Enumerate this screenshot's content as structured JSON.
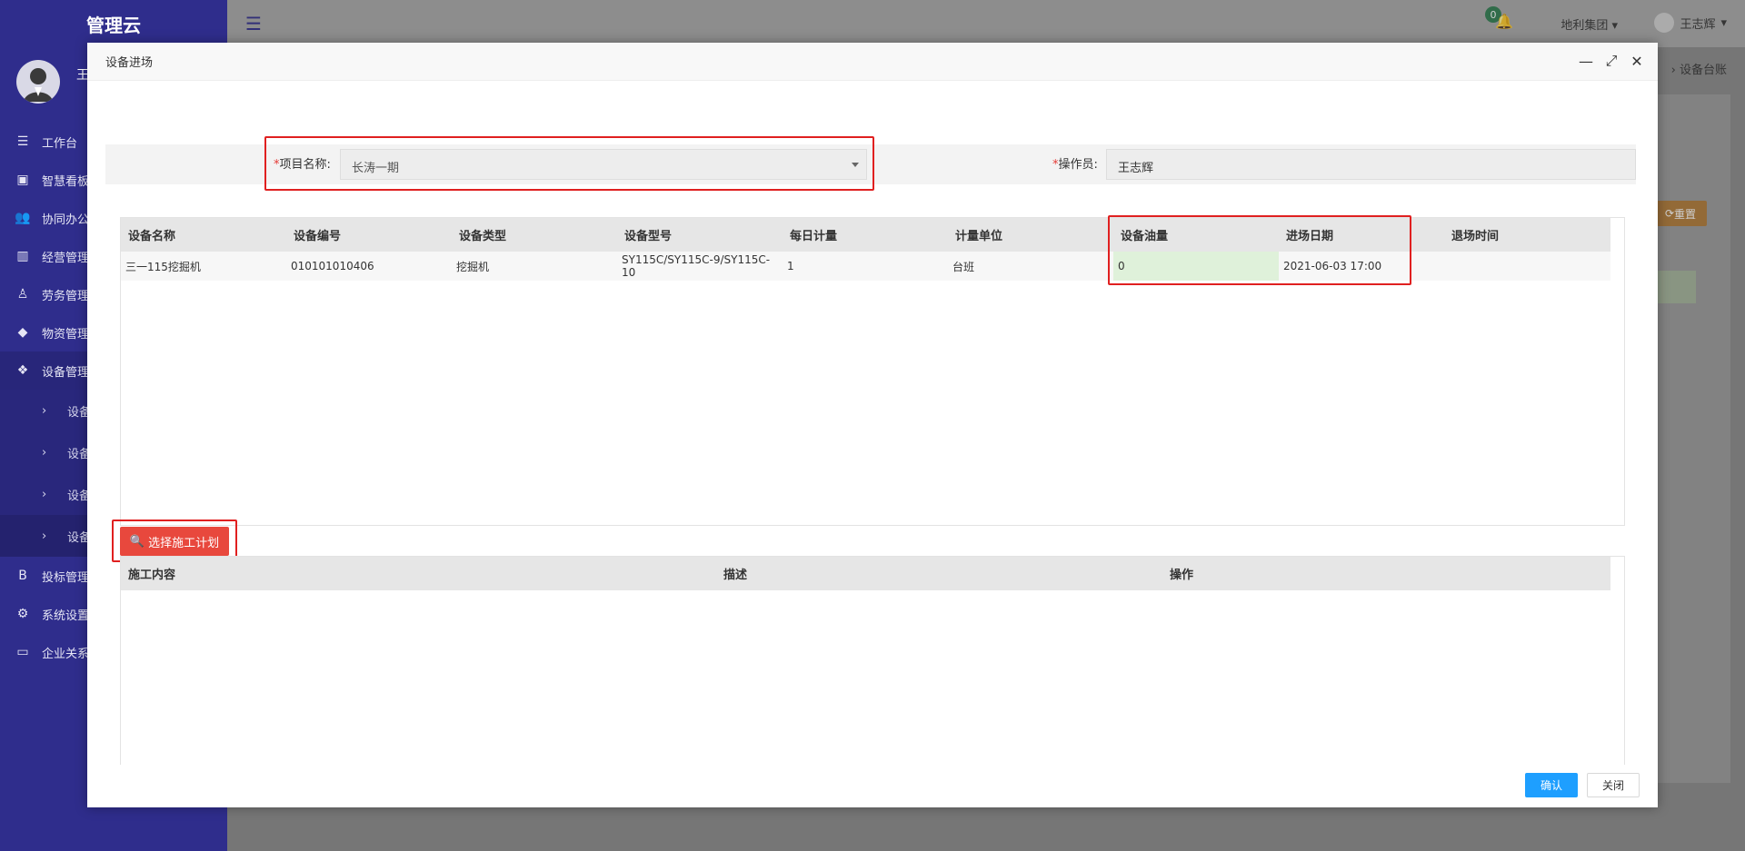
{
  "app": {
    "logo": "管理云",
    "user_short": "王"
  },
  "sidebar": {
    "items": [
      {
        "icon": "list-icon",
        "glyph": "☰",
        "label": "工作台"
      },
      {
        "icon": "dashboard-icon",
        "glyph": "▣",
        "label": "智慧看板"
      },
      {
        "icon": "users-icon",
        "glyph": "👥",
        "label": "协同办公"
      },
      {
        "icon": "bar-chart-icon",
        "glyph": "▥",
        "label": "经营管理"
      },
      {
        "icon": "worker-icon",
        "glyph": "♙",
        "label": "劳务管理"
      },
      {
        "icon": "cube-icon",
        "glyph": "◆",
        "label": "物资管理"
      },
      {
        "icon": "cubes-icon",
        "glyph": "❖",
        "label": "设备管理"
      }
    ],
    "sub_items": [
      {
        "label": "设备"
      },
      {
        "label": "设备"
      },
      {
        "label": "设备"
      },
      {
        "label": "设备"
      }
    ],
    "items_after": [
      {
        "icon": "bold-b-icon",
        "glyph": "B",
        "label": "投标管理"
      },
      {
        "icon": "gear-icon",
        "glyph": "⚙",
        "label": "系统设置"
      },
      {
        "icon": "monitor-icon",
        "glyph": "▭",
        "label": "企业关系"
      }
    ]
  },
  "topbar": {
    "notification_count": "0",
    "group": "地利集团",
    "user": "王志辉",
    "breadcrumb": "› 设备台账",
    "reset_label": "重置"
  },
  "modal": {
    "title": "设备进场",
    "form": {
      "project_label": "项目名称:",
      "project_value": "长涛一期",
      "operator_label": "操作员:",
      "operator_value": "王志辉",
      "required_mark": "*"
    },
    "equipment_table": {
      "headers": [
        "设备名称",
        "设备编号",
        "设备类型",
        "设备型号",
        "每日计量",
        "计量单位",
        "设备油量",
        "进场日期",
        "退场时间"
      ],
      "rows": [
        [
          "三一115挖掘机",
          "010101010406",
          "挖掘机",
          "SY115C/SY115C-9/SY115C-10",
          "1",
          "台班",
          "0",
          "2021-06-03 17:00",
          ""
        ]
      ]
    },
    "plan_button": "选择施工计划",
    "plan_table": {
      "headers": [
        "施工内容",
        "描述",
        "操作"
      ]
    },
    "confirm_label": "确认",
    "close_label": "关闭"
  }
}
